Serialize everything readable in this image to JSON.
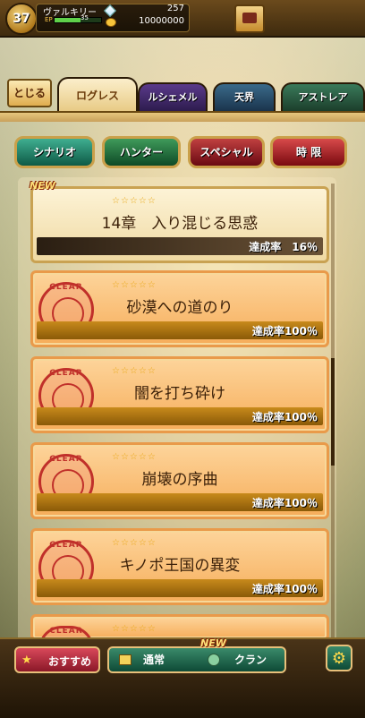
{
  "status": {
    "level": "37",
    "player_name": "ヴァルキリー",
    "ep_label": "EP",
    "ep_value": "35",
    "ep_fill_fraction": 0.55,
    "gems": "257",
    "coins": "10000000"
  },
  "nav": {
    "close_label": "とじる",
    "tabs": [
      {
        "label": "ログレス",
        "active": true
      },
      {
        "label": "ルシェメル"
      },
      {
        "label": "天界"
      },
      {
        "label": "アストレア"
      }
    ]
  },
  "categories": [
    "シナリオ",
    "ハンター",
    "スペシャル",
    "時 限"
  ],
  "chapters": [
    {
      "title": "14章　入り混じる思惑",
      "stars": "☆☆☆☆☆",
      "progress_label": "達成率",
      "progress": "16％",
      "new": "NEW"
    },
    {
      "title": "砂漠への道のり",
      "stars": "☆☆☆☆☆",
      "progress_label": "達成率",
      "progress": "100％",
      "seal": "CLEAR"
    },
    {
      "title": "闇を打ち砕け",
      "stars": "☆☆☆☆☆",
      "progress_label": "達成率",
      "progress": "100％",
      "seal": "CLEAR"
    },
    {
      "title": "崩壊の序曲",
      "stars": "☆☆☆☆☆",
      "progress_label": "達成率",
      "progress": "100％",
      "seal": "CLEAR"
    },
    {
      "title": "キノポ王国の異変",
      "stars": "☆☆☆☆☆",
      "progress_label": "達成率",
      "progress": "100％",
      "seal": "CLEAR"
    },
    {
      "stars": "☆☆☆☆☆",
      "seal": "CLEAR"
    }
  ],
  "bottom": {
    "recommend_label": "おすすめ",
    "normal_label": "通常",
    "clan_label": "クラン",
    "clan_badge": "NEW"
  },
  "colors": {
    "clear_seal": "#c0302a",
    "star": "#e8a818",
    "progress_bar": "#c88a1c"
  }
}
